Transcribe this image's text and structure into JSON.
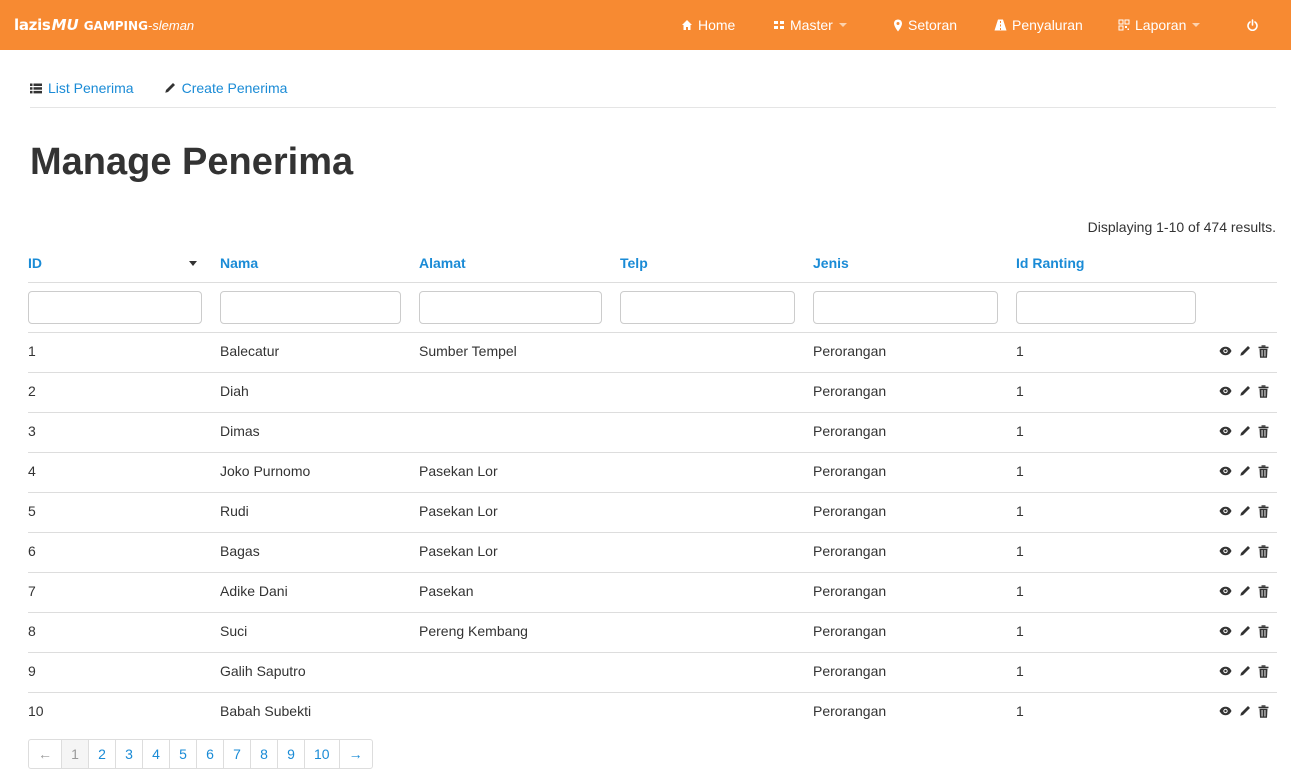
{
  "colors": {
    "navbar_bg": "#f78a32",
    "link": "#1a8bd6",
    "text": "#333333",
    "border": "#dddddd"
  },
  "brand": {
    "lazis": "lazis",
    "mu": "MU",
    "gamping": "GAMPING",
    "sleman": "-sleman"
  },
  "nav": [
    {
      "label": "Home",
      "icon": "home-icon",
      "dropdown": false
    },
    {
      "label": "Master",
      "icon": "grid-icon",
      "dropdown": true
    },
    {
      "label": "Setoran",
      "icon": "map-marker-icon",
      "dropdown": false
    },
    {
      "label": "Penyaluran",
      "icon": "road-icon",
      "dropdown": false
    },
    {
      "label": "Laporan",
      "icon": "qrcode-icon",
      "dropdown": true
    },
    {
      "label": "",
      "icon": "power-icon",
      "dropdown": false
    }
  ],
  "subnav": {
    "list_label": "List Penerima",
    "create_label": "Create Penerima"
  },
  "page_title": "Manage Penerima",
  "summary": "Displaying 1-10 of 474 results.",
  "table": {
    "columns": [
      "ID",
      "Nama",
      "Alamat",
      "Telp",
      "Jenis",
      "Id Ranting"
    ],
    "sorted_column": "ID",
    "rows": [
      {
        "id": "1",
        "nama": "Balecatur",
        "alamat": "Sumber Tempel",
        "telp": "",
        "jenis": "Perorangan",
        "id_ranting": "1"
      },
      {
        "id": "2",
        "nama": "Diah",
        "alamat": "",
        "telp": "",
        "jenis": "Perorangan",
        "id_ranting": "1"
      },
      {
        "id": "3",
        "nama": "Dimas",
        "alamat": "",
        "telp": "",
        "jenis": "Perorangan",
        "id_ranting": "1"
      },
      {
        "id": "4",
        "nama": "Joko Purnomo",
        "alamat": "Pasekan Lor",
        "telp": "",
        "jenis": "Perorangan",
        "id_ranting": "1"
      },
      {
        "id": "5",
        "nama": "Rudi",
        "alamat": "Pasekan Lor",
        "telp": "",
        "jenis": "Perorangan",
        "id_ranting": "1"
      },
      {
        "id": "6",
        "nama": "Bagas",
        "alamat": "Pasekan Lor",
        "telp": "",
        "jenis": "Perorangan",
        "id_ranting": "1"
      },
      {
        "id": "7",
        "nama": "Adike Dani",
        "alamat": "Pasekan",
        "telp": "",
        "jenis": "Perorangan",
        "id_ranting": "1"
      },
      {
        "id": "8",
        "nama": "Suci",
        "alamat": "Pereng Kembang",
        "telp": "",
        "jenis": "Perorangan",
        "id_ranting": "1"
      },
      {
        "id": "9",
        "nama": "Galih Saputro",
        "alamat": "",
        "telp": "",
        "jenis": "Perorangan",
        "id_ranting": "1"
      },
      {
        "id": "10",
        "nama": "Babah Subekti",
        "alamat": "",
        "telp": "",
        "jenis": "Perorangan",
        "id_ranting": "1"
      }
    ],
    "row_action_icons": [
      "eye-icon",
      "pencil-icon",
      "trash-icon"
    ]
  },
  "pagination": {
    "prev": "←",
    "next": "→",
    "pages": [
      "1",
      "2",
      "3",
      "4",
      "5",
      "6",
      "7",
      "8",
      "9",
      "10"
    ],
    "current": "1"
  }
}
